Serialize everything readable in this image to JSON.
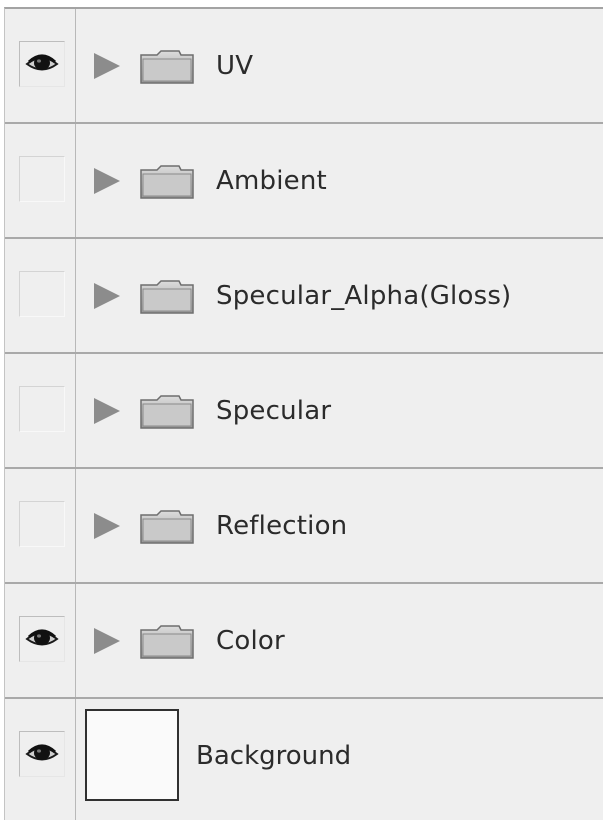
{
  "layers": [
    {
      "label": "UV",
      "visible": true,
      "type": "group"
    },
    {
      "label": "Ambient",
      "visible": false,
      "type": "group"
    },
    {
      "label": "Specular_Alpha(Gloss)",
      "visible": false,
      "type": "group"
    },
    {
      "label": "Specular",
      "visible": false,
      "type": "group"
    },
    {
      "label": "Reflection",
      "visible": false,
      "type": "group"
    },
    {
      "label": "Color",
      "visible": true,
      "type": "group"
    },
    {
      "label": "Background",
      "visible": true,
      "type": "layer"
    }
  ],
  "icons": {
    "visibility": "eye-icon",
    "expand": "triangle-right-icon",
    "group": "folder-icon"
  },
  "colors": {
    "panel_bg": "#efefef",
    "divider": "#a9a9a9",
    "text": "#2b2b2b",
    "triangle": "#8c8c8c"
  }
}
